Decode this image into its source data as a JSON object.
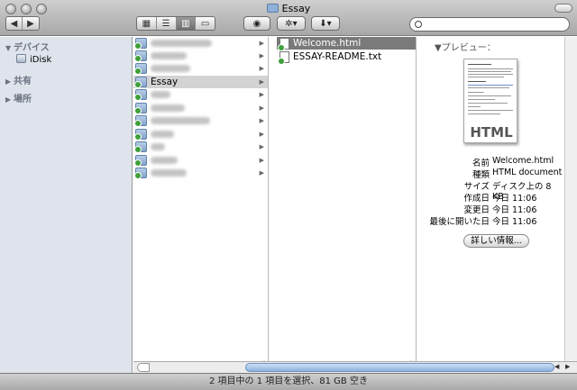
{
  "window": {
    "title": "Essay"
  },
  "toolbar": {
    "back_label": "◀",
    "forward_label": "▶",
    "view_icons": [
      "▦",
      "☰",
      "▥",
      "▭"
    ],
    "eye_label": "◉",
    "action_label": "✲▾",
    "share_label": "⬇▾",
    "search_placeholder": ""
  },
  "sidebar": {
    "sections": [
      {
        "label": "デバイス",
        "expanded": true,
        "items": [
          "iDisk"
        ]
      },
      {
        "label": "共有",
        "expanded": false,
        "items": []
      },
      {
        "label": "場所",
        "expanded": false,
        "items": []
      }
    ]
  },
  "column1": {
    "selected": "Essay"
  },
  "column2": {
    "items": [
      {
        "name": "Welcome.html"
      },
      {
        "name": "ESSAY-README.txt"
      }
    ]
  },
  "preview": {
    "heading": "プレビュー：",
    "thumb_label": "HTML",
    "info": [
      {
        "key": "名前",
        "value": "Welcome.html"
      },
      {
        "key": "種類",
        "value": "HTML document"
      },
      {
        "key": "サイズ",
        "value": "ディスク上の 8 KB"
      },
      {
        "key": "作成日",
        "value": "今日 11:06"
      },
      {
        "key": "変更日",
        "value": "今日 11:06"
      },
      {
        "key": "最後に開いた日",
        "value": "今日 11:06"
      }
    ],
    "more_button": "詳しい情報..."
  },
  "status": {
    "text": "2 項目中の 1 項目を選択、81 GB 空き"
  }
}
